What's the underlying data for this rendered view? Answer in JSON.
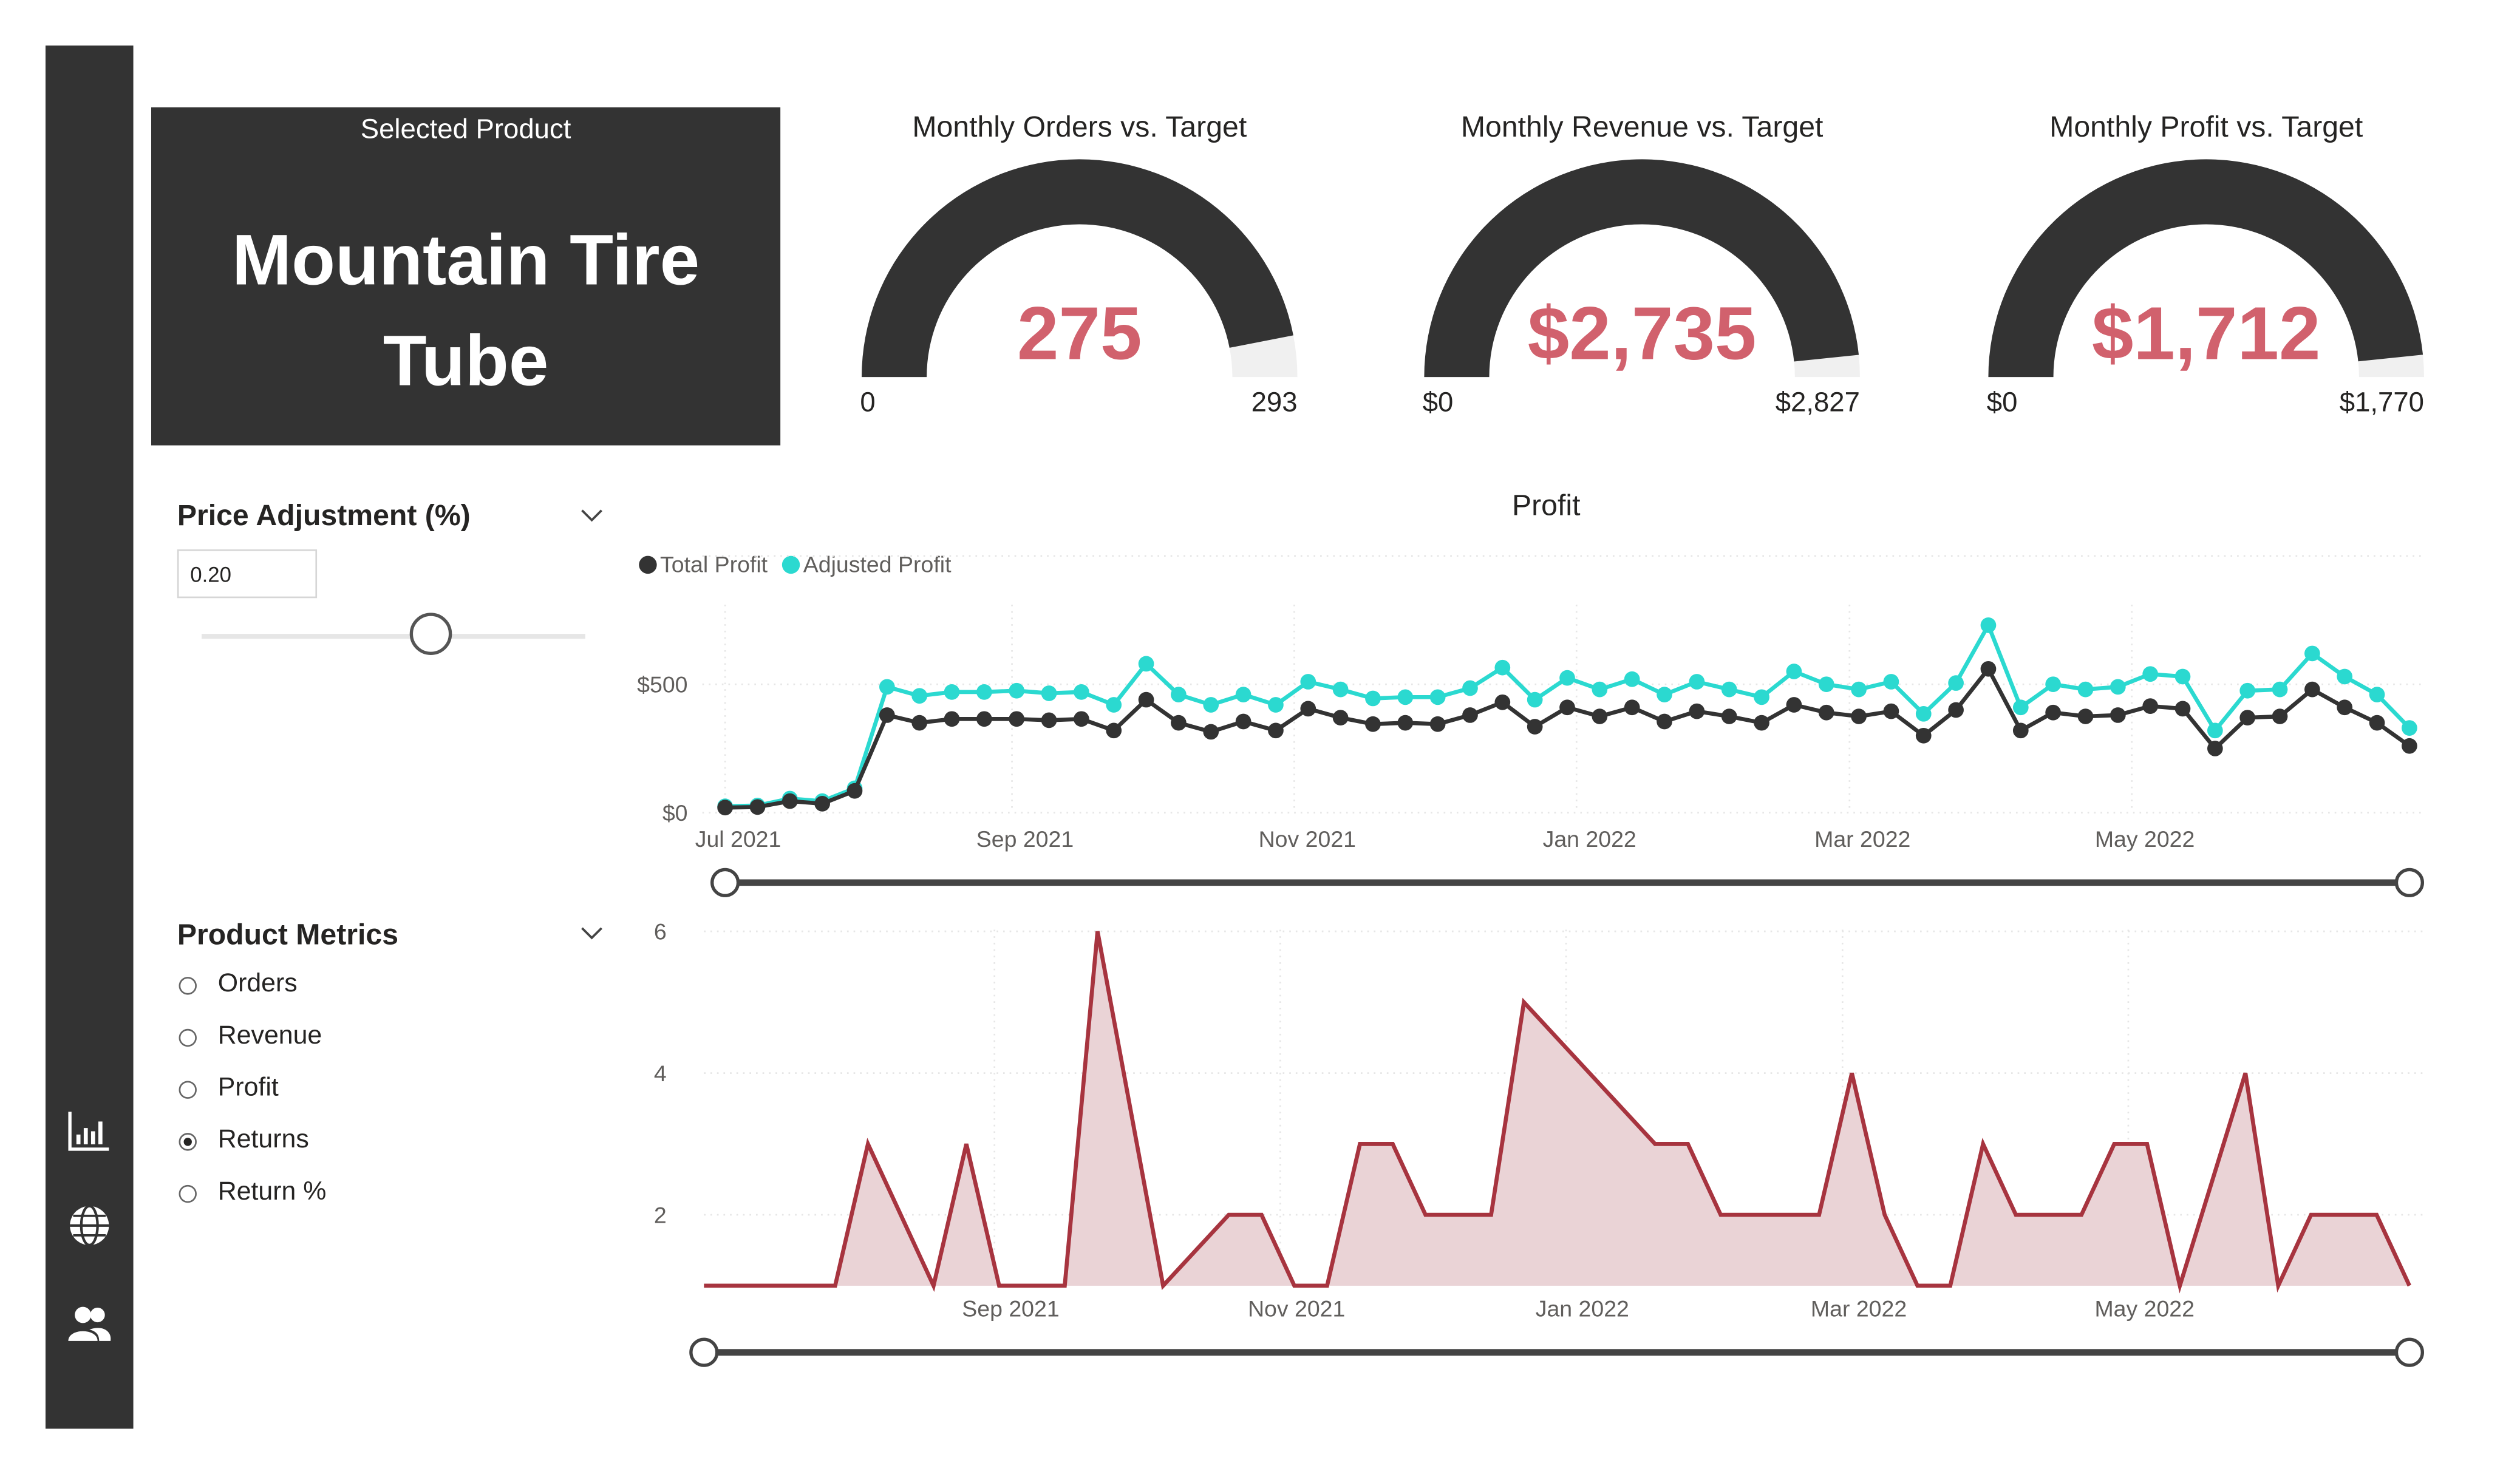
{
  "nav": {
    "icons": [
      "bar-chart-icon",
      "globe-icon",
      "users-icon"
    ]
  },
  "product_card": {
    "caption": "Selected Product",
    "name": "Mountain Tire Tube"
  },
  "gauges": [
    {
      "title": "Monthly Orders vs. Target",
      "value": 275,
      "value_label": "275",
      "min_label": "0",
      "max_label": "293",
      "min": 0,
      "max": 293
    },
    {
      "title": "Monthly Revenue vs. Target",
      "value": 2735,
      "value_label": "$2,735",
      "min_label": "$0",
      "max_label": "$2,827",
      "min": 0,
      "max": 2827
    },
    {
      "title": "Monthly Profit vs. Target",
      "value": 1712,
      "value_label": "$1,712",
      "min_label": "$0",
      "max_label": "$1,770",
      "min": 0,
      "max": 1770
    }
  ],
  "price_adjustment": {
    "title": "Price Adjustment (%)",
    "value": "0.20",
    "slider_fraction": 0.6
  },
  "product_metrics": {
    "title": "Product Metrics",
    "options": [
      "Orders",
      "Revenue",
      "Profit",
      "Returns",
      "Return %"
    ],
    "selected": "Returns"
  },
  "colors": {
    "dark": "#333333",
    "accent_value": "#d1616d",
    "total_profit": "#333333",
    "adjusted_profit": "#2bd9d0",
    "returns_line": "#a7343f",
    "returns_fill": "#ead3d6"
  },
  "chart_data": [
    {
      "type": "line",
      "title": "Profit",
      "x_ticks": [
        "Jul 2021",
        "Sep 2021",
        "Nov 2021",
        "Jan 2022",
        "Mar 2022",
        "May 2022"
      ],
      "y_ticks": [
        "$0",
        "$500"
      ],
      "ylim": [
        0,
        1000
      ],
      "x_start": "2021-07-01",
      "x_step_days": 7,
      "grid": true,
      "legend": "top-left",
      "series": [
        {
          "name": "Total Profit",
          "values": [
            20,
            22,
            45,
            35,
            85,
            380,
            350,
            365,
            365,
            365,
            360,
            365,
            320,
            440,
            350,
            315,
            355,
            320,
            405,
            370,
            345,
            350,
            345,
            380,
            430,
            335,
            410,
            375,
            410,
            355,
            395,
            375,
            350,
            420,
            390,
            375,
            395,
            300,
            400,
            560,
            320,
            390,
            375,
            380,
            415,
            405,
            250,
            370,
            375,
            480,
            410,
            350,
            260
          ]
        },
        {
          "name": "Adjusted Profit",
          "values": [
            25,
            28,
            55,
            45,
            95,
            490,
            455,
            470,
            470,
            475,
            465,
            470,
            420,
            580,
            460,
            420,
            460,
            420,
            510,
            480,
            445,
            450,
            450,
            485,
            565,
            440,
            525,
            480,
            520,
            460,
            510,
            480,
            450,
            550,
            500,
            480,
            510,
            385,
            505,
            730,
            410,
            500,
            480,
            490,
            540,
            530,
            320,
            475,
            480,
            620,
            530,
            460,
            330
          ]
        }
      ]
    },
    {
      "type": "area",
      "series_label": "Returns",
      "x_ticks": [
        "Sep 2021",
        "Nov 2021",
        "Jan 2022",
        "Mar 2022",
        "May 2022"
      ],
      "y_ticks": [
        "2",
        "4",
        "6"
      ],
      "ylim": [
        1,
        6
      ],
      "x_start": "2021-07-01",
      "x_step_days": 7,
      "grid": true,
      "values": [
        1,
        1,
        1,
        1,
        1,
        3,
        2,
        1,
        3,
        1,
        1,
        1,
        6,
        3.5,
        1,
        1.5,
        2,
        2,
        1,
        1,
        3,
        3,
        2,
        2,
        2,
        5,
        4.5,
        4,
        3.5,
        3,
        3,
        2,
        2,
        2,
        2,
        4,
        2,
        1,
        1,
        3,
        2,
        2,
        2,
        3,
        3,
        1,
        2.5,
        4,
        1,
        2,
        2,
        2,
        1
      ]
    }
  ]
}
